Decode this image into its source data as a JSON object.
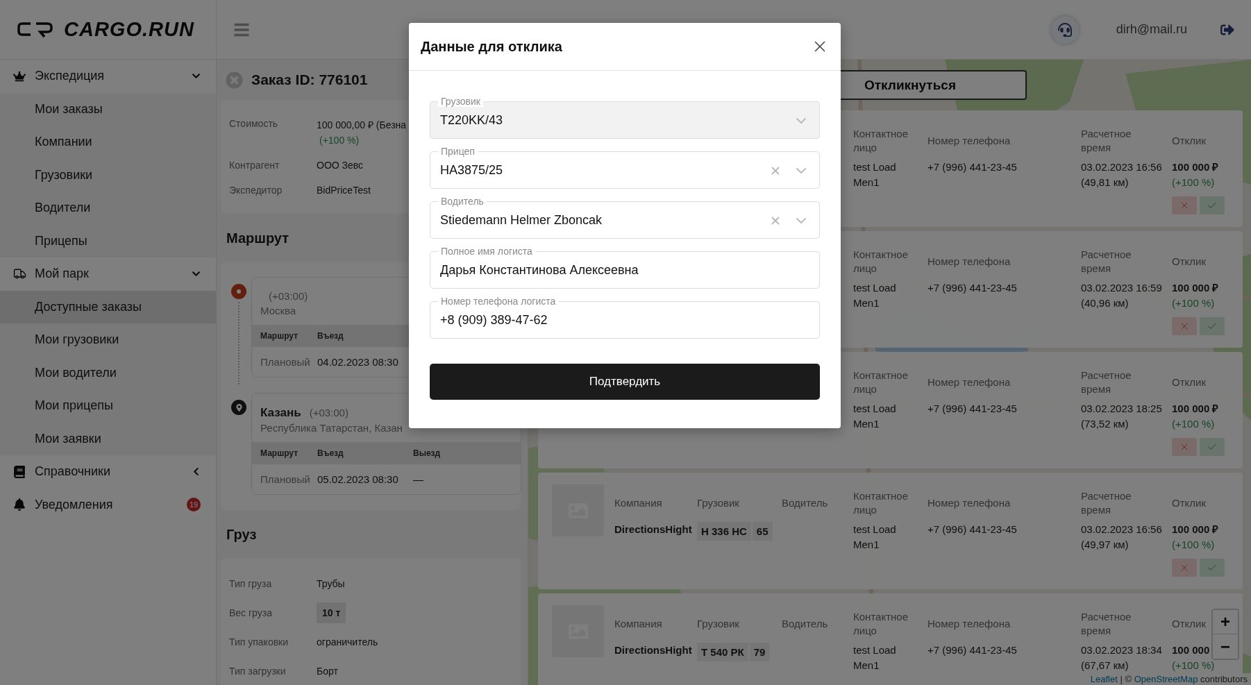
{
  "sidebar": {
    "logo": "CARGO.RUN",
    "groups": [
      {
        "kind": "group",
        "label": "Экспедиция",
        "expanded": true,
        "children": [
          {
            "label": "Мои заказы",
            "selected": false
          },
          {
            "label": "Компании",
            "selected": false
          },
          {
            "label": "Грузовики",
            "selected": false
          },
          {
            "label": "Водители",
            "selected": false
          },
          {
            "label": "Прицепы",
            "selected": false
          }
        ]
      },
      {
        "kind": "group",
        "label": "Мой парк",
        "expanded": true,
        "children": [
          {
            "label": "Доступные заказы",
            "selected": true
          },
          {
            "label": "Мои грузовики",
            "selected": false
          },
          {
            "label": "Мои водители",
            "selected": false
          },
          {
            "label": "Мои прицепы",
            "selected": false
          },
          {
            "label": "Мои заявки",
            "selected": false
          }
        ]
      },
      {
        "kind": "group",
        "label": "Справочники",
        "expanded": false
      },
      {
        "kind": "link",
        "label": "Уведомления",
        "badge": "19"
      }
    ]
  },
  "topbar": {
    "user": "dirh@mail.ru"
  },
  "order": {
    "title": "Заказ ID: 776101",
    "details": [
      {
        "label": "Стоимость",
        "value": "100 000,00 ₽ (Безна",
        "note": "(+100 %)"
      },
      {
        "label": "Контрагент",
        "value": "ООО Зевс"
      },
      {
        "label": "Экспедитор",
        "value": "BidPriceTest"
      }
    ]
  },
  "route": {
    "title": "Маршрут",
    "points": [
      {
        "kind": "start",
        "tz": "(+03:00)",
        "address": "Москва",
        "columns": [
          "Маршрут",
          "Въезд"
        ],
        "rows": [
          [
            "Плановый",
            "04.02.2023 08:30"
          ]
        ]
      },
      {
        "kind": "end",
        "city": "Казань",
        "tz": "(+03:00)",
        "address": "Республика Татарстан, Казан",
        "columns": [
          "Маршрут",
          "Въезд",
          "Выезд"
        ],
        "rows": [
          [
            "Плановый",
            "05.02.2023 08:30",
            "—"
          ]
        ]
      }
    ]
  },
  "cargo": {
    "title": "Груз",
    "details": [
      {
        "kind": "plain",
        "label": "Тип груза",
        "value": "Трубы"
      },
      {
        "kind": "tag",
        "label": "Вес груза",
        "value": "10 т"
      },
      {
        "kind": "plain",
        "label": "Тип упаковки",
        "value": "ограничитель"
      },
      {
        "kind": "plain",
        "label": "Тип загрузки",
        "value": "Борт"
      }
    ]
  },
  "map": {
    "respond_button": "Откликнуться",
    "cards": [
      {
        "headers": {
          "contact": "Контактное лицо",
          "phone": "Номер телефона",
          "time": "Расчетное время",
          "response": "Отклик"
        },
        "contact": "test Load Men1",
        "phone": "+7 (996) 441-23-45",
        "time": "03.02.2023 16:56",
        "distance": "(49,81 км)",
        "price": "100 000 ₽",
        "change": "(+100 %)",
        "actions": true
      },
      {
        "headers": {
          "contact": "Контактное лицо",
          "phone": "Номер телефона",
          "time": "Расчетное время",
          "response": "Отклик"
        },
        "contact": "test Load Men1",
        "phone": "+7 (996) 441-23-45",
        "time": "03.02.2023 16:59",
        "distance": "(40,96 км)",
        "price": "100 000 ₽",
        "change": "(+100 %)",
        "actions": true
      },
      {
        "headers": {
          "contact": "Контактное лицо",
          "phone": "Номер телефона",
          "time": "Расчетное время",
          "response": "Отклик"
        },
        "contact": "test Load Men1",
        "phone": "+7 (996) 441-23-45",
        "time": "03.02.2023 18:25",
        "distance": "(73,52 км)",
        "price": "100 000 ₽",
        "change": "(+100 %)",
        "actions": true
      },
      {
        "headers": {
          "company": "Компания",
          "truck": "Грузовик",
          "driver": "Водитель",
          "contact": "Контактное лицо",
          "phone": "Номер телефона",
          "time": "Расчетное время",
          "response": "Отклик"
        },
        "company": "DirectionsHight",
        "plate": {
          "number": "Н 336 НС",
          "region": "65"
        },
        "contact": "test Load Men1",
        "phone": "+7 (996) 441-23-45",
        "time": "03.02.2023 16:56",
        "distance": "(49,97 км)",
        "price": "100 000 ₽",
        "change": "(+100 %)",
        "actions": true
      },
      {
        "headers": {
          "company": "Компания",
          "truck": "Грузовик",
          "driver": "Водитель",
          "contact": "Контактное лицо",
          "phone": "Номер телефона",
          "time": "Расчетное время",
          "response": "Отклик"
        },
        "company": "DirectionsHight",
        "plate": {
          "number": "Т 540 РК",
          "region": "79"
        },
        "contact": "test Load Men1",
        "phone": "+7 (996) 441-23-45",
        "time": "03.02.2023 18:34",
        "distance": "(67,67 км)",
        "price": "100 000",
        "change": "(+100 %)"
      }
    ],
    "zoom_in": "+",
    "zoom_out": "−",
    "attribution": {
      "leaflet": "Leaflet",
      "separator": "| ©",
      "osm": "OpenStreetMap",
      "suffix": "contributors"
    }
  },
  "modal": {
    "title": "Данные для отклика",
    "fields": [
      {
        "kind": "select",
        "label": "Грузовик",
        "value": "T220KK/43",
        "disabled": true,
        "clearable": false
      },
      {
        "kind": "select",
        "label": "Прицеп",
        "value": "HA3875/25",
        "disabled": false,
        "clearable": true
      },
      {
        "kind": "select",
        "label": "Водитель",
        "value": "Stiedemann Helmer Zboncak",
        "disabled": false,
        "clearable": true
      },
      {
        "kind": "text",
        "label": "Полное имя логиста",
        "value": "Дарья Константинова Алексеевна",
        "disabled": false,
        "clearable": false
      },
      {
        "kind": "text",
        "label": "Номер телефона логиста",
        "value": "+8 (909) 389-47-62",
        "disabled": false,
        "clearable": false
      }
    ],
    "confirm_button": "Подтвердить"
  }
}
